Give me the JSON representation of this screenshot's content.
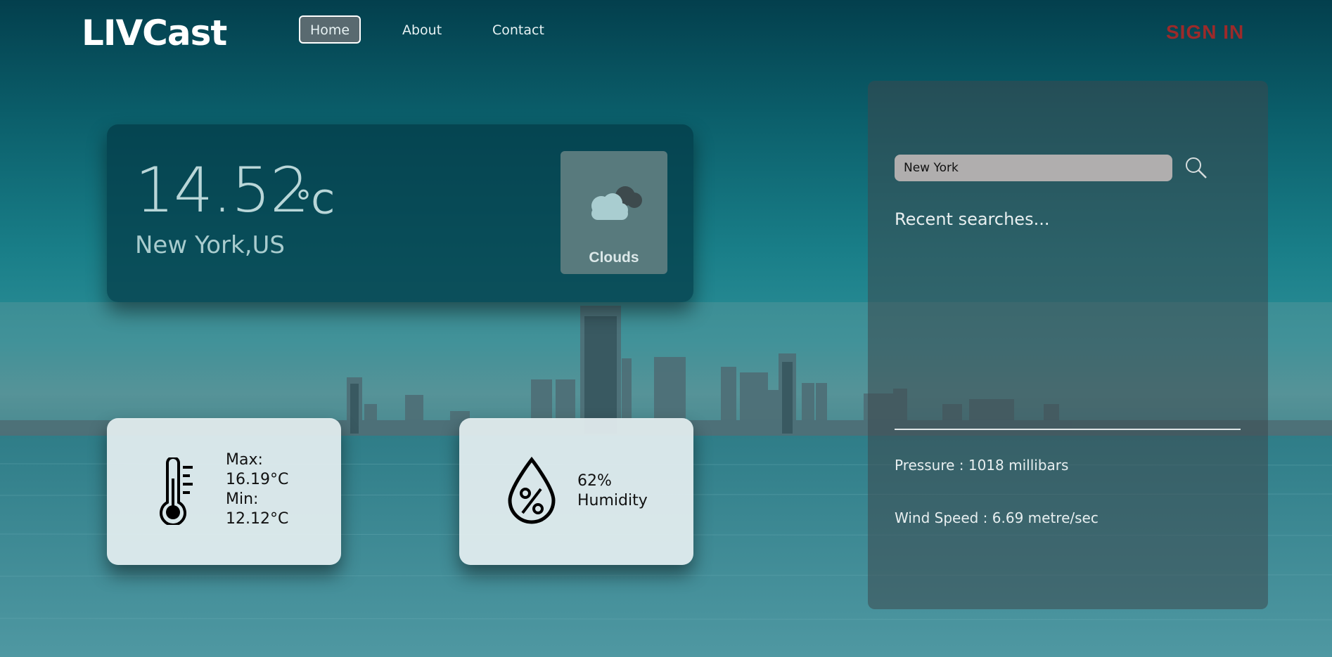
{
  "nav": {
    "logo": "LIVCast",
    "items": [
      {
        "label": "Home"
      },
      {
        "label": "About"
      },
      {
        "label": "Contact"
      }
    ],
    "signin": "SIGN IN"
  },
  "current": {
    "temperature": "14.52",
    "unit": "°C",
    "city": "New York,US",
    "condition": "Clouds",
    "condition_icon": "cloud-icon"
  },
  "temp_card": {
    "max_label": "Max:",
    "max_value": "16.19°C",
    "min_label": "Min:",
    "min_value": "12.12°C",
    "icon": "thermometer-icon"
  },
  "humidity_card": {
    "value": "62%",
    "label": "Humidity",
    "icon": "humidity-drop-icon"
  },
  "panel": {
    "search_value": "New York",
    "search_icon": "search-icon",
    "recent_heading": "Recent searches...",
    "pressure": "Pressure : 1018 millibars",
    "wind": "Wind Speed : 6.69 metre/sec"
  },
  "colors": {
    "signin": "#9c2a2a",
    "main_card": "#033a46",
    "condition_box": "#587a7d",
    "search_input": "#b0aeae"
  }
}
